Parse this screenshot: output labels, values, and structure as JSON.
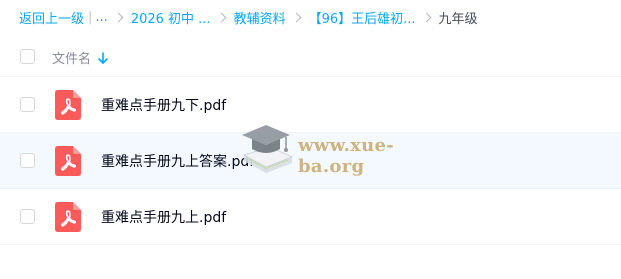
{
  "breadcrumb": {
    "back_label": "返回上一级",
    "pipe": "|",
    "ellipsis": "...",
    "items": [
      {
        "label": "2026 初中 ..."
      },
      {
        "label": "教辅资料"
      },
      {
        "label": "【96】王后雄初..."
      }
    ],
    "current": "九年级"
  },
  "header": {
    "name_column": "文件名",
    "sort_direction": "descending"
  },
  "files": [
    {
      "name": "重难点手册九下.pdf",
      "type": "pdf-icon"
    },
    {
      "name": "重难点手册九上答案.pdf",
      "type": "pdf-icon"
    },
    {
      "name": "重难点手册九上.pdf",
      "type": "pdf-icon"
    }
  ],
  "watermark": {
    "text": "www.xue-ba.org"
  },
  "colors": {
    "link": "#06a7ff",
    "pdf": "#fa5a5a",
    "row_hover": "#f3f9ff",
    "watermark": "#c8a768"
  }
}
